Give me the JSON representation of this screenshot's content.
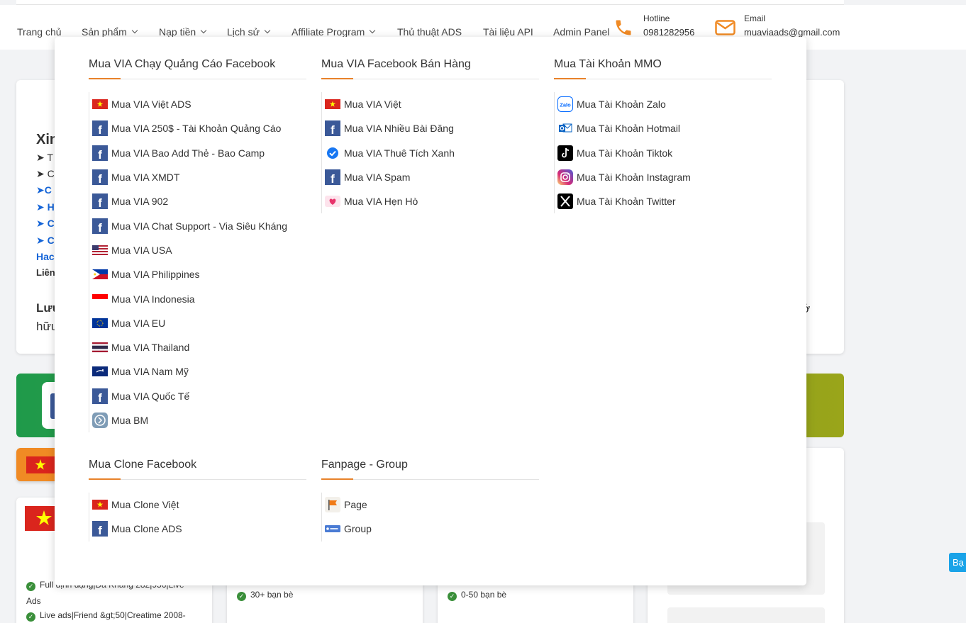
{
  "nav": {
    "items": [
      {
        "label": "Trang chủ",
        "dropdown": false
      },
      {
        "label": "Sản phẩm",
        "dropdown": true
      },
      {
        "label": "Nạp tiền",
        "dropdown": true
      },
      {
        "label": "Lịch sử",
        "dropdown": true
      },
      {
        "label": "Affiliate Program",
        "dropdown": true
      },
      {
        "label": "Thủ thuật ADS",
        "dropdown": false
      },
      {
        "label": "Tài liệu API",
        "dropdown": false
      },
      {
        "label": "Admin Panel",
        "dropdown": false
      }
    ],
    "hotline_label": "Hotline",
    "hotline_value": "0981282956",
    "email_label": "Email",
    "email_value": "muaviaads@gmail.com",
    "accent": "#f08a24"
  },
  "background": {
    "fragments": [
      "Xin",
      "➤ T",
      "➤ C",
      "➤C",
      "➤ H",
      "➤ C",
      "➤ C",
      "Hac",
      "Liên",
      "Lưu",
      "hữu",
      "ở"
    ],
    "features_1": [
      "Full định dạng|Đa Kháng 282|956|Live",
      "Ads",
      "Live ads|Friend &gt;50|Creatime 2008-"
    ],
    "features_2": [
      "30+ bạn bè"
    ],
    "features_3": [
      "0-50 bạn bè"
    ],
    "side_tab": "Bạ"
  },
  "menu": {
    "sections": [
      {
        "title": "Mua VIA Chạy Quảng Cáo Facebook",
        "items": [
          {
            "label": "Mua VIA Việt ADS",
            "icon": "vn-flag-icon"
          },
          {
            "label": "Mua VIA 250$ - Tài Khoản Quảng Cáo",
            "icon": "facebook-icon"
          },
          {
            "label": "Mua VIA Bao Add Thẻ - Bao Camp",
            "icon": "facebook-icon"
          },
          {
            "label": "Mua VIA XMDT",
            "icon": "facebook-icon"
          },
          {
            "label": "Mua VIA 902",
            "icon": "facebook-icon"
          },
          {
            "label": "Mua VIA Chat Support - Via Siêu Kháng",
            "icon": "facebook-icon"
          },
          {
            "label": "Mua VIA USA",
            "icon": "us-flag-icon"
          },
          {
            "label": "Mua VIA Philippines",
            "icon": "ph-flag-icon"
          },
          {
            "label": "Mua VIA Indonesia",
            "icon": "id-flag-icon"
          },
          {
            "label": "Mua VIA EU",
            "icon": "eu-flag-icon"
          },
          {
            "label": "Mua VIA Thailand",
            "icon": "th-flag-icon"
          },
          {
            "label": "Mua VIA Nam Mỹ",
            "icon": "south-america-flag-icon"
          },
          {
            "label": "Mua VIA Quốc Tế",
            "icon": "facebook-icon"
          },
          {
            "label": "Mua BM",
            "icon": "business-manager-icon"
          }
        ]
      },
      {
        "title": "Mua VIA Facebook Bán Hàng",
        "items": [
          {
            "label": "Mua VIA Việt",
            "icon": "vn-flag-icon"
          },
          {
            "label": "Mua VIA Nhiều Bài Đăng",
            "icon": "facebook-icon"
          },
          {
            "label": "Mua VIA Thuê Tích Xanh",
            "icon": "verified-badge-icon"
          },
          {
            "label": "Mua VIA Spam",
            "icon": "facebook-icon"
          },
          {
            "label": "Mua VIA Hẹn Hò",
            "icon": "dating-heart-icon"
          }
        ]
      },
      {
        "title": "Mua Tài Khoản MMO",
        "items": [
          {
            "label": "Mua Tài Khoản Zalo",
            "icon": "zalo-icon"
          },
          {
            "label": "Mua Tài Khoản Hotmail",
            "icon": "outlook-icon"
          },
          {
            "label": "Mua Tài Khoản Tiktok",
            "icon": "tiktok-icon"
          },
          {
            "label": "Mua Tài Khoản Instagram",
            "icon": "instagram-icon"
          },
          {
            "label": "Mua Tài Khoản Twitter",
            "icon": "x-twitter-icon"
          }
        ]
      },
      {
        "title": "Mua Clone Facebook",
        "items": [
          {
            "label": "Mua Clone Việt",
            "icon": "vn-flag-icon"
          },
          {
            "label": "Mua Clone ADS",
            "icon": "facebook-icon"
          }
        ]
      },
      {
        "title": "Fanpage - Group",
        "items": [
          {
            "label": "Page",
            "icon": "page-flag-icon"
          },
          {
            "label": "Group",
            "icon": "group-badge-icon"
          }
        ]
      }
    ]
  }
}
